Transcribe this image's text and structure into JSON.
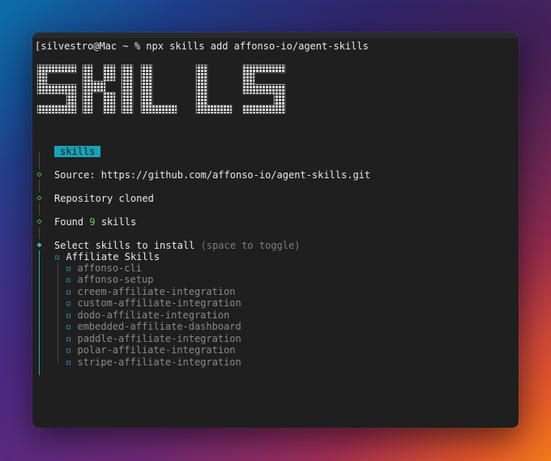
{
  "terminal": {
    "prompt_line": "[silvestro@Mac ~ % npx skills add affonso-io/agent-skills",
    "logo_text": "SKILLS",
    "badge": "skills",
    "steps": [
      {
        "prefix": "Source: ",
        "value": "https://github.com/affonso-io/agent-skills.git"
      },
      {
        "text": "Repository cloned"
      },
      {
        "prefix": "Found ",
        "count": "9",
        "suffix": " skills"
      }
    ],
    "select": {
      "label": "Select skills to install",
      "hint": "(space to toggle)",
      "group": "Affiliate Skills",
      "items": [
        "affonso-cli",
        "affonso-setup",
        "creem-affiliate-integration",
        "custom-affiliate-integration",
        "dodo-affiliate-integration",
        "embedded-affiliate-dashboard",
        "paddle-affiliate-integration",
        "polar-affiliate-integration",
        "stripe-affiliate-integration"
      ]
    }
  },
  "colors": {
    "badge": "#17a2b8",
    "count": "#5fd35f",
    "checkbox": "#2aa5bd",
    "diamond_done": "#5fd35f",
    "diamond_active": "#3fb3c9"
  },
  "icons": [
    "diamond-icon",
    "checkbox-icon"
  ]
}
